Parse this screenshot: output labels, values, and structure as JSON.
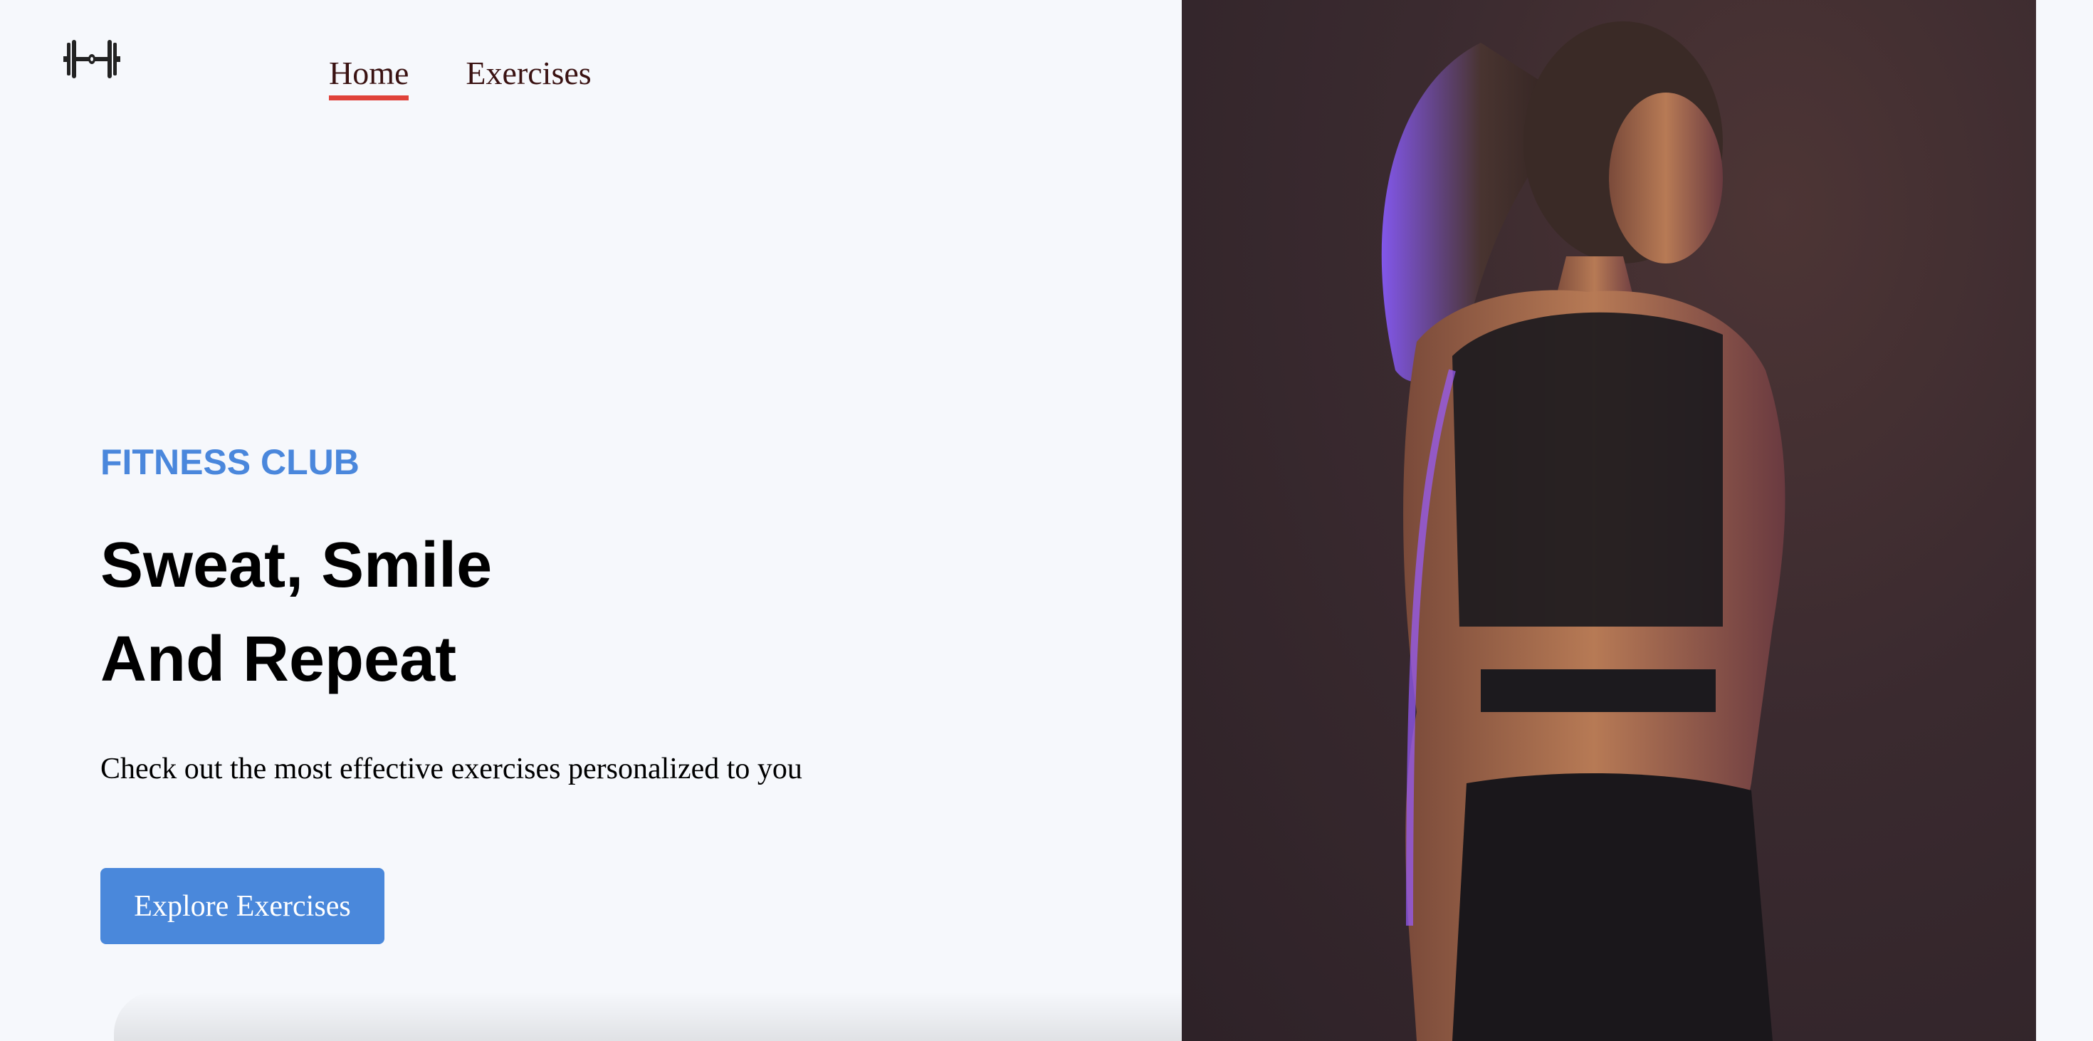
{
  "navbar": {
    "logo_icon": "dumbbell-icon",
    "links": [
      {
        "label": "Home",
        "active": true
      },
      {
        "label": "Exercises",
        "active": false
      }
    ],
    "active_underline_color": "#e0423a"
  },
  "hero": {
    "kicker": "FITNESS CLUB",
    "headline_line1": "Sweat, Smile",
    "headline_line2": "And Repeat",
    "description": "Check out the most effective exercises personalized to you",
    "cta_label": "Explore Exercises",
    "accent_color": "#4a88db"
  }
}
